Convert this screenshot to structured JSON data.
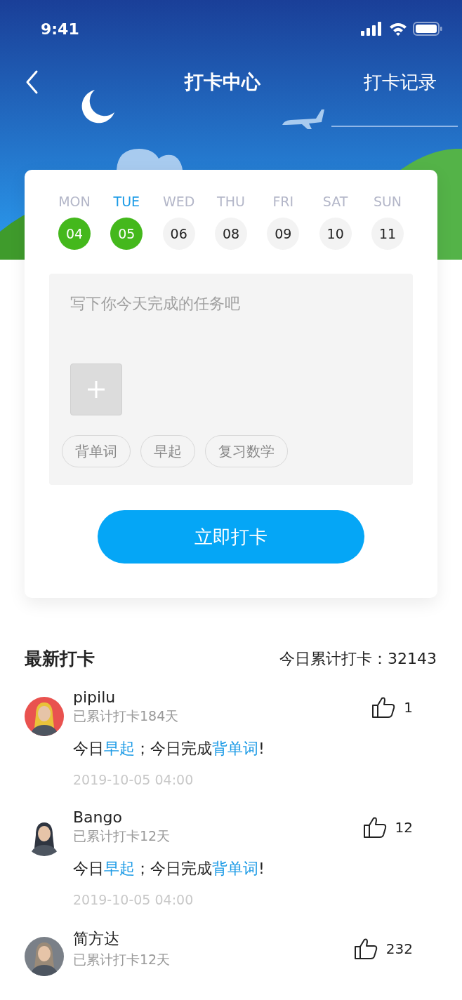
{
  "status_bar": {
    "time": "9:41"
  },
  "nav": {
    "title": "打卡中心",
    "action": "打卡记录"
  },
  "days": [
    {
      "day": "MON",
      "date": "04",
      "checked": true,
      "selected": false
    },
    {
      "day": "TUE",
      "date": "05",
      "checked": true,
      "selected": true
    },
    {
      "day": "WED",
      "date": "06",
      "checked": false,
      "selected": false
    },
    {
      "day": "THU",
      "date": "08",
      "checked": false,
      "selected": false
    },
    {
      "day": "FRI",
      "date": "09",
      "checked": false,
      "selected": false
    },
    {
      "day": "SAT",
      "date": "10",
      "checked": false,
      "selected": false
    },
    {
      "day": "SUN",
      "date": "11",
      "checked": false,
      "selected": false
    }
  ],
  "task_input": {
    "placeholder": "写下你今天完成的任务吧"
  },
  "tags": [
    "背单词",
    "早起",
    "复习数学"
  ],
  "submit_button": "立即打卡",
  "feed": {
    "title": "最新打卡",
    "total_label": "今日累计打卡：32143",
    "items": [
      {
        "name": "pipilu",
        "streak": "已累计打卡184天",
        "likes": "1",
        "message": [
          {
            "text": "今日",
            "highlight": false
          },
          {
            "text": "早起",
            "highlight": true
          },
          {
            "text": "；今日完成",
            "highlight": false
          },
          {
            "text": "背单词",
            "highlight": true
          },
          {
            "text": "!",
            "highlight": false
          }
        ],
        "time": "2019-10-05 04:00"
      },
      {
        "name": "Bango",
        "streak": "已累计打卡12天",
        "likes": "12",
        "message": [
          {
            "text": "今日",
            "highlight": false
          },
          {
            "text": "早起",
            "highlight": true
          },
          {
            "text": "；今日完成",
            "highlight": false
          },
          {
            "text": "背单词",
            "highlight": true
          },
          {
            "text": "!",
            "highlight": false
          }
        ],
        "time": "2019-10-05 04:00"
      },
      {
        "name": "简方达",
        "streak": "已累计打卡12天",
        "likes": "232"
      }
    ]
  }
}
